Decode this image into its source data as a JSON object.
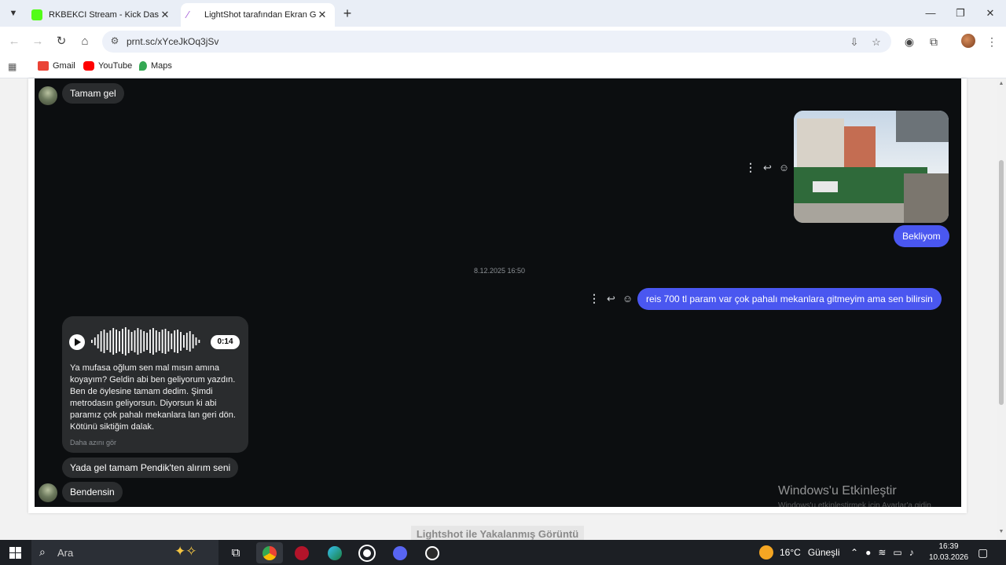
{
  "browser": {
    "tabs": [
      {
        "title": "RKBEKCI Stream - Kick Dashboard",
        "favicon_color": "#53fc18",
        "active": false
      },
      {
        "title": "LightShot tarafından Ekran Görüntüsü",
        "favicon_color": "#a35bd6",
        "active": true
      }
    ],
    "new_tab": "+",
    "url": "prnt.sc/xYceJkOq3jSv",
    "bookmarks": [
      {
        "label": "Gmail",
        "color": "#ea4335"
      },
      {
        "label": "YouTube",
        "color": "#ff0000"
      },
      {
        "label": "Maps",
        "color": "#34a853"
      }
    ]
  },
  "chat": {
    "messages_top": [
      {
        "side": "in",
        "text": "Tamam gel"
      }
    ],
    "sent_image_reply": "Bekliyom",
    "timestamp": "8.12.2025 16:50",
    "sent_text": "reis 700 tl param var çok pahalı mekanlara gitmeyim ama sen bilirsin",
    "voice": {
      "duration": "0:14",
      "transcript": "Ya mufasa oğlum sen mal mısın amına koyayım? Geldin abi ben geliyorum yazdın. Ben de öylesine tamam dedim. Şimdi metrodasın geliyorsun. Diyorsun ki abi paramız çok pahalı mekanlara lan geri dön. Kötünü siktiğim dalak.",
      "see_less": "Daha azını gör"
    },
    "messages_bottom": [
      {
        "side": "in",
        "text": "Yada gel tamam Pendik'ten alırım seni"
      },
      {
        "side": "in",
        "text": "Bendensin"
      }
    ],
    "accent": "#4a57f0"
  },
  "overlay": {
    "watermark_title": "Windows'u Etkinleştir",
    "watermark_sub": "Windows'u etkinleştirmek için Ayarlar'a gidin.",
    "caption": "Lightshot ile Yakalanmış Görüntü"
  },
  "taskbar": {
    "search_placeholder": "Ara",
    "weather": "16°C",
    "weather_desc": "Güneşli",
    "time": "16:39",
    "date": "10.03.2026"
  }
}
